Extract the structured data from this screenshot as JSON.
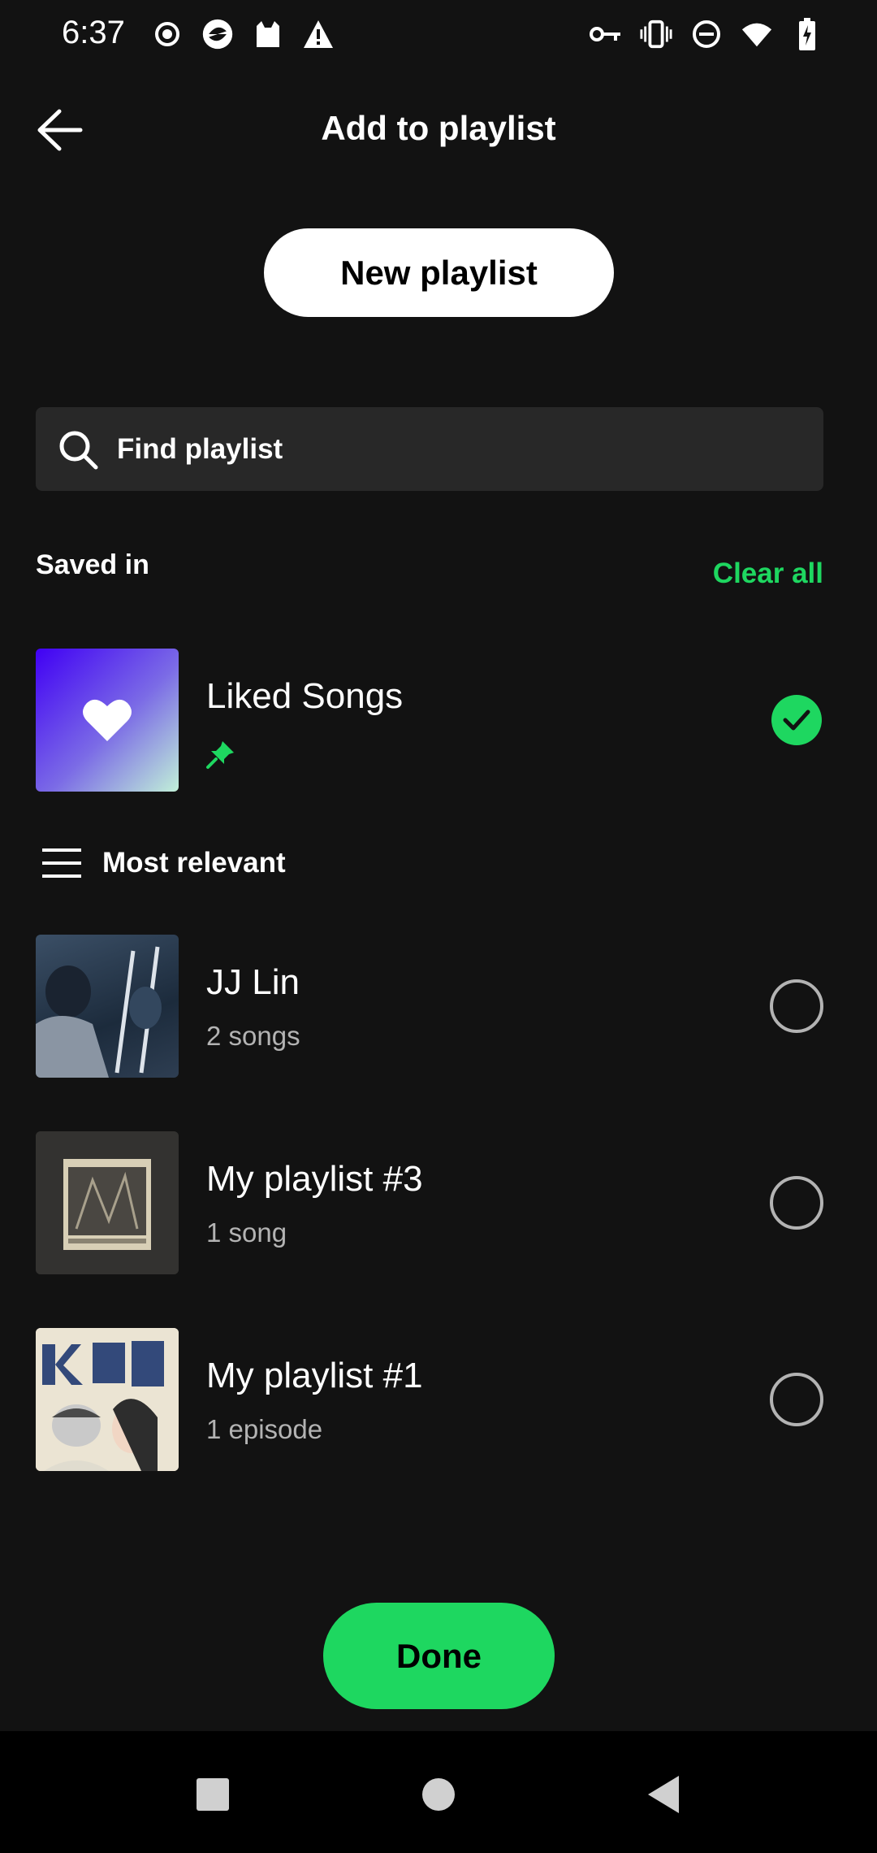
{
  "status_bar": {
    "time": "6:37",
    "left_icons": [
      "record-icon",
      "app-icon",
      "cat-icon",
      "alert-icon"
    ],
    "right_icons": [
      "vpn-key-icon",
      "vibrate-icon",
      "dnd-icon",
      "wifi-icon",
      "battery-charging-icon"
    ]
  },
  "header": {
    "title": "Add to playlist"
  },
  "new_playlist_label": "New playlist",
  "search": {
    "placeholder": "Find playlist"
  },
  "saved_in": {
    "label": "Saved in",
    "clear_all": "Clear all",
    "items": [
      {
        "title": "Liked Songs",
        "pinned": true,
        "checked": true
      }
    ]
  },
  "sort": {
    "label": "Most relevant"
  },
  "playlists": [
    {
      "title": "JJ Lin",
      "subtitle": "2 songs",
      "checked": false
    },
    {
      "title": "My playlist #3",
      "subtitle": "1 song",
      "checked": false
    },
    {
      "title": "My playlist #1",
      "subtitle": "1 episode",
      "checked": false
    }
  ],
  "done_label": "Done",
  "colors": {
    "background": "#121212",
    "accent": "#1ed760",
    "search_bg": "#282828",
    "secondary_text": "#b3b3b3"
  }
}
